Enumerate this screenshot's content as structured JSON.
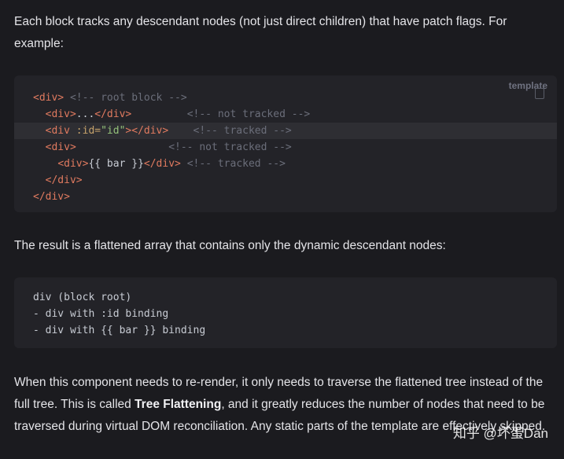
{
  "paragraphs": {
    "intro": "Each block tracks any descendant nodes (not just direct children) that have patch flags. For example:",
    "result": "The result is a flattened array that contains only the dynamic descendant nodes:",
    "outro_before": "When this component needs to re-render, it only needs to traverse the flattened tree instead of the full tree. This is called ",
    "outro_bold": "Tree Flattening",
    "outro_after": ", and it greatly reduces the number of nodes that need to be traversed during virtual DOM reconciliation. Any static parts of the template are effectively skipped."
  },
  "code_block_1": {
    "language": "template",
    "lines": [
      {
        "indent": "",
        "open": "<div>",
        "rest": "",
        "close": "",
        "comment": " <!-- root block -->",
        "highlight": false
      },
      {
        "indent": "  ",
        "open": "<div>",
        "rest": "...",
        "close": "</div>",
        "comment": "         <!-- not tracked -->",
        "highlight": false
      },
      {
        "indent": "  ",
        "open": "<div",
        "attr": " :id=",
        "str": "\"id\"",
        "rest": ">",
        "close": "</div>",
        "comment": "    <!-- tracked -->",
        "highlight": true
      },
      {
        "indent": "  ",
        "open": "<div>",
        "rest": "",
        "close": "",
        "comment": "               <!-- not tracked -->",
        "highlight": false
      },
      {
        "indent": "    ",
        "open": "<div>",
        "rest": "{{ bar }}",
        "close": "</div>",
        "comment": " <!-- tracked -->",
        "highlight": false
      },
      {
        "indent": "  ",
        "open": "</div>",
        "rest": "",
        "close": "",
        "comment": "",
        "highlight": false
      },
      {
        "indent": "",
        "open": "</div>",
        "rest": "",
        "close": "",
        "comment": "",
        "highlight": false
      }
    ]
  },
  "code_block_2": {
    "lines": [
      "div (block root)",
      "- div with :id binding",
      "- div with {{ bar }} binding"
    ]
  },
  "watermark": "知乎 @坏蛋Dan"
}
